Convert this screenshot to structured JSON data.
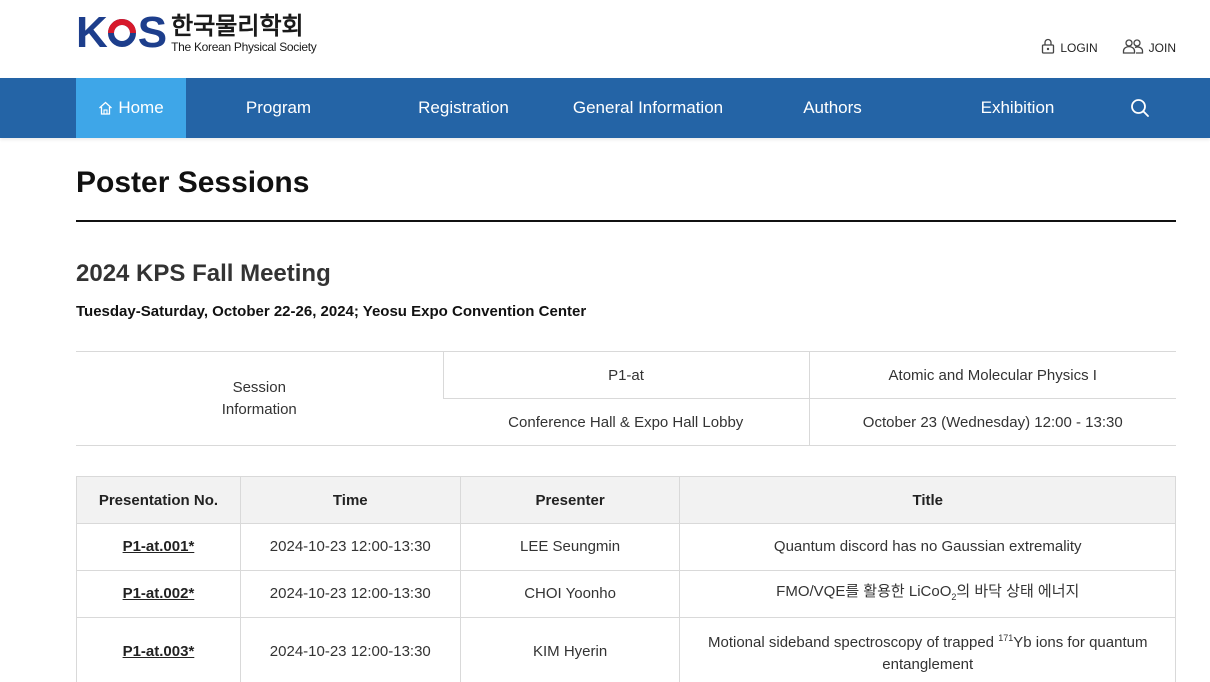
{
  "logo": {
    "mark_left": "K",
    "mark_right": "S",
    "korean": "한국물리학회",
    "english": "The Korean Physical Society",
    "colors": {
      "blue": "#1d3e8c",
      "red": "#d7192b"
    }
  },
  "util": {
    "login": "LOGIN",
    "join": "JOIN"
  },
  "nav": {
    "items": [
      {
        "label": "Home",
        "icon": "home-icon",
        "active": true
      },
      {
        "label": "Program"
      },
      {
        "label": "Registration"
      },
      {
        "label": "General Information"
      },
      {
        "label": "Authors"
      },
      {
        "label": "Exhibition"
      }
    ],
    "search_icon": "search-icon",
    "colors": {
      "bar": "#2464a6",
      "active": "#3ea6e8"
    }
  },
  "page": {
    "title": "Poster Sessions",
    "meeting": "2024 KPS Fall Meeting",
    "meeting_sub": "Tuesday-Saturday, October 22-26, 2024; Yeosu Expo Convention Center"
  },
  "session": {
    "label_line1": "Session",
    "label_line2": "Information",
    "code": "P1-at",
    "name": "Atomic and Molecular Physics I",
    "location": "Conference Hall & Expo Hall Lobby",
    "time": "October 23 (Wednesday) 12:00 - 13:30"
  },
  "table": {
    "headers": [
      "Presentation No.",
      "Time",
      "Presenter",
      "Title"
    ],
    "rows": [
      {
        "no": "P1-at.001*",
        "time": "2024-10-23 12:00-13:30",
        "presenter": "LEE Seungmin",
        "title": "Quantum discord has no Gaussian extremality"
      },
      {
        "no": "P1-at.002*",
        "time": "2024-10-23 12:00-13:30",
        "presenter": "CHOI Yoonho",
        "title_a": "FMO/VQE를 활용한 LiCoO",
        "title_sub": "2",
        "title_b": "의 바닥 상태 에너지"
      },
      {
        "no": "P1-at.003*",
        "time": "2024-10-23 12:00-13:30",
        "presenter": "KIM Hyerin",
        "title_a": "Motional sideband spectroscopy of trapped ",
        "title_sup": "171",
        "title_b": "Yb ions for quantum entanglement"
      }
    ]
  }
}
